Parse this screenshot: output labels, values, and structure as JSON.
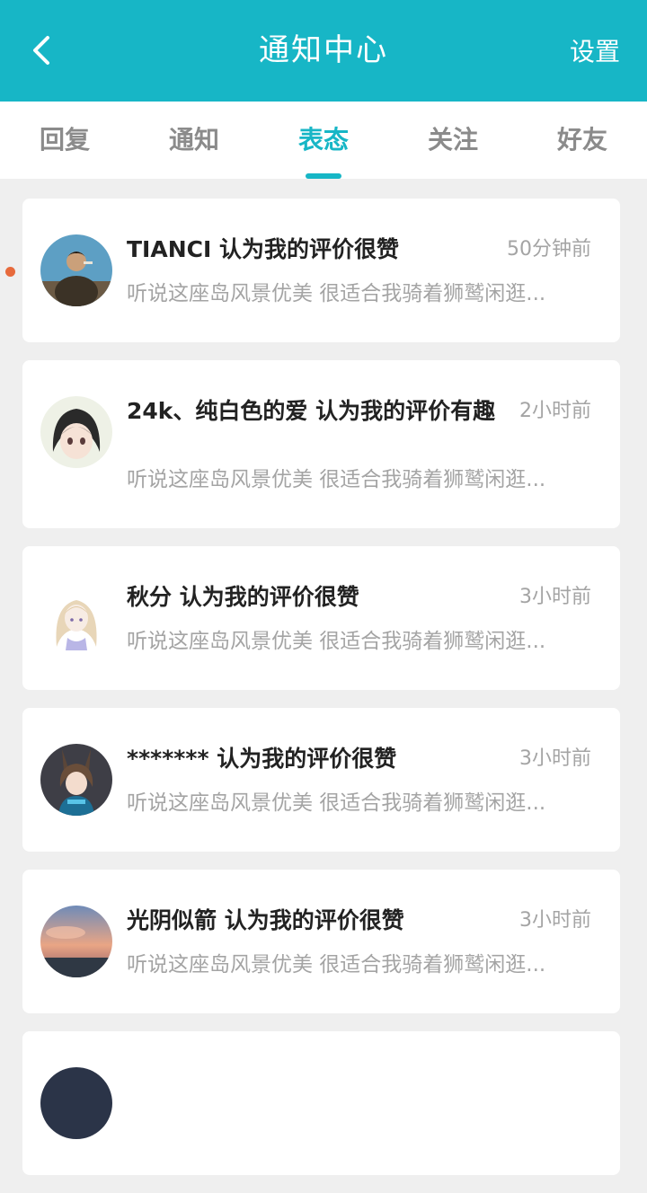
{
  "header": {
    "title": "通知中心",
    "settings_label": "设置",
    "back_icon": "chevron-left-icon",
    "background_color": "#17b6c6"
  },
  "tabs": [
    {
      "label": "回复",
      "active": false
    },
    {
      "label": "通知",
      "active": false
    },
    {
      "label": "表态",
      "active": true
    },
    {
      "label": "关注",
      "active": false
    },
    {
      "label": "好友",
      "active": false
    }
  ],
  "accent_color": "#17b6c6",
  "unread_color": "#e76a3c",
  "notifications": [
    {
      "title": "TIANCI 认为我的评价很赞",
      "time": "50分钟前",
      "snippet": "听说这座岛风景优美 很适合我骑着狮鹫闲逛...",
      "unread": true
    },
    {
      "title": "24k、纯白色的爱 认为我的评价有趣",
      "time": "2小时前",
      "snippet": "听说这座岛风景优美 很适合我骑着狮鹫闲逛...",
      "unread": false
    },
    {
      "title": "秋分 认为我的评价很赞",
      "time": "3小时前",
      "snippet": "听说这座岛风景优美 很适合我骑着狮鹫闲逛...",
      "unread": false
    },
    {
      "title": "******* 认为我的评价很赞",
      "time": "3小时前",
      "snippet": "听说这座岛风景优美 很适合我骑着狮鹫闲逛...",
      "unread": false
    },
    {
      "title": "光阴似箭 认为我的评价很赞",
      "time": "3小时前",
      "snippet": "听说这座岛风景优美 很适合我骑着狮鹫闲逛...",
      "unread": false
    }
  ]
}
